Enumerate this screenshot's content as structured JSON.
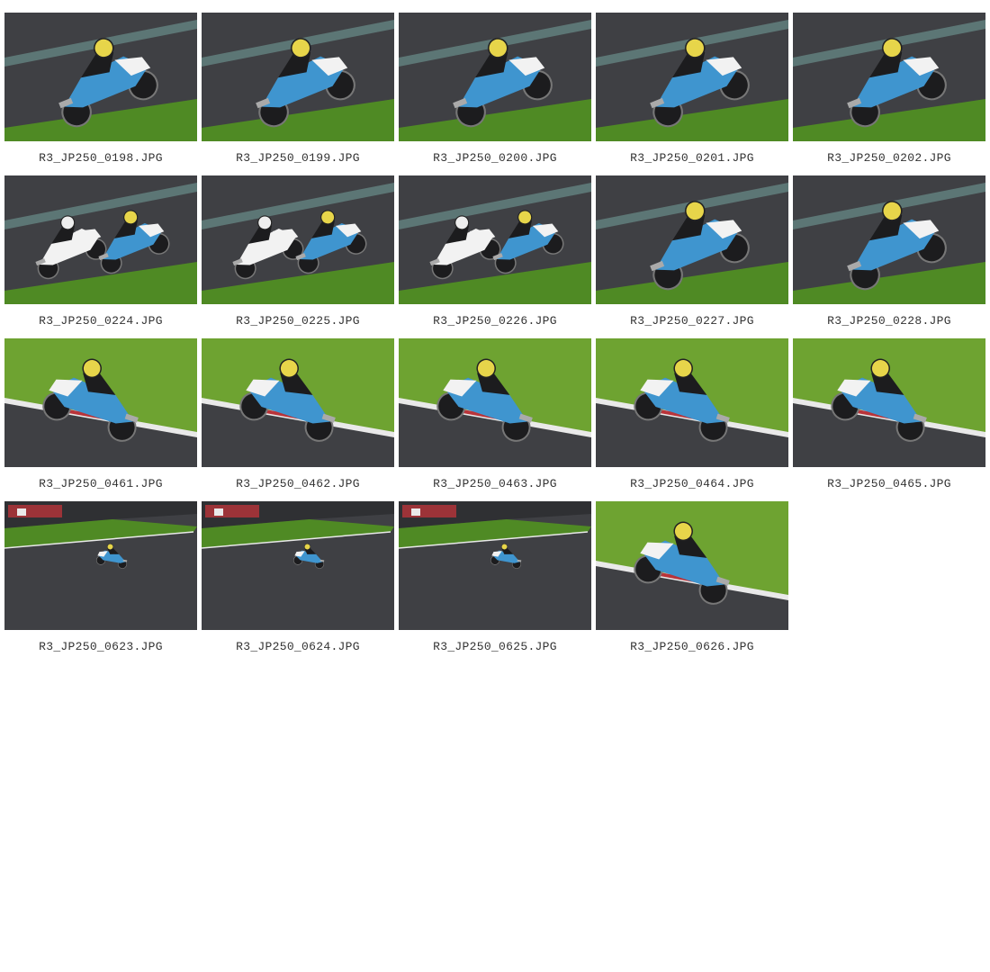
{
  "colors": {
    "asphalt": "#3f4044",
    "asphalt_dark": "#2f3033",
    "grass": "#4f8a24",
    "grass_light": "#6ea331",
    "kerb_red": "#b8343a",
    "kerb_white": "#e9e9e9",
    "bike_blue": "#3f95cf",
    "bike_white": "#f2f2f2",
    "bike_black": "#1c1c1e",
    "helmet_yellow": "#e7d54a",
    "caption_text": "#333333"
  },
  "gallery": {
    "items": [
      {
        "filename": "R3_JP250_0198.JPG",
        "scene": "lean-left"
      },
      {
        "filename": "R3_JP250_0199.JPG",
        "scene": "lean-left"
      },
      {
        "filename": "R3_JP250_0200.JPG",
        "scene": "lean-left"
      },
      {
        "filename": "R3_JP250_0201.JPG",
        "scene": "lean-left"
      },
      {
        "filename": "R3_JP250_0202.JPG",
        "scene": "lean-left"
      },
      {
        "filename": "R3_JP250_0224.JPG",
        "scene": "two-riders"
      },
      {
        "filename": "R3_JP250_0225.JPG",
        "scene": "two-riders"
      },
      {
        "filename": "R3_JP250_0226.JPG",
        "scene": "two-riders"
      },
      {
        "filename": "R3_JP250_0227.JPG",
        "scene": "lean-left"
      },
      {
        "filename": "R3_JP250_0228.JPG",
        "scene": "lean-left"
      },
      {
        "filename": "R3_JP250_0461.JPG",
        "scene": "lean-right"
      },
      {
        "filename": "R3_JP250_0462.JPG",
        "scene": "lean-right"
      },
      {
        "filename": "R3_JP250_0463.JPG",
        "scene": "lean-right"
      },
      {
        "filename": "R3_JP250_0464.JPG",
        "scene": "lean-right"
      },
      {
        "filename": "R3_JP250_0465.JPG",
        "scene": "lean-right"
      },
      {
        "filename": "R3_JP250_0623.JPG",
        "scene": "distant"
      },
      {
        "filename": "R3_JP250_0624.JPG",
        "scene": "distant"
      },
      {
        "filename": "R3_JP250_0625.JPG",
        "scene": "distant"
      },
      {
        "filename": "R3_JP250_0626.JPG",
        "scene": "lean-right"
      }
    ]
  }
}
